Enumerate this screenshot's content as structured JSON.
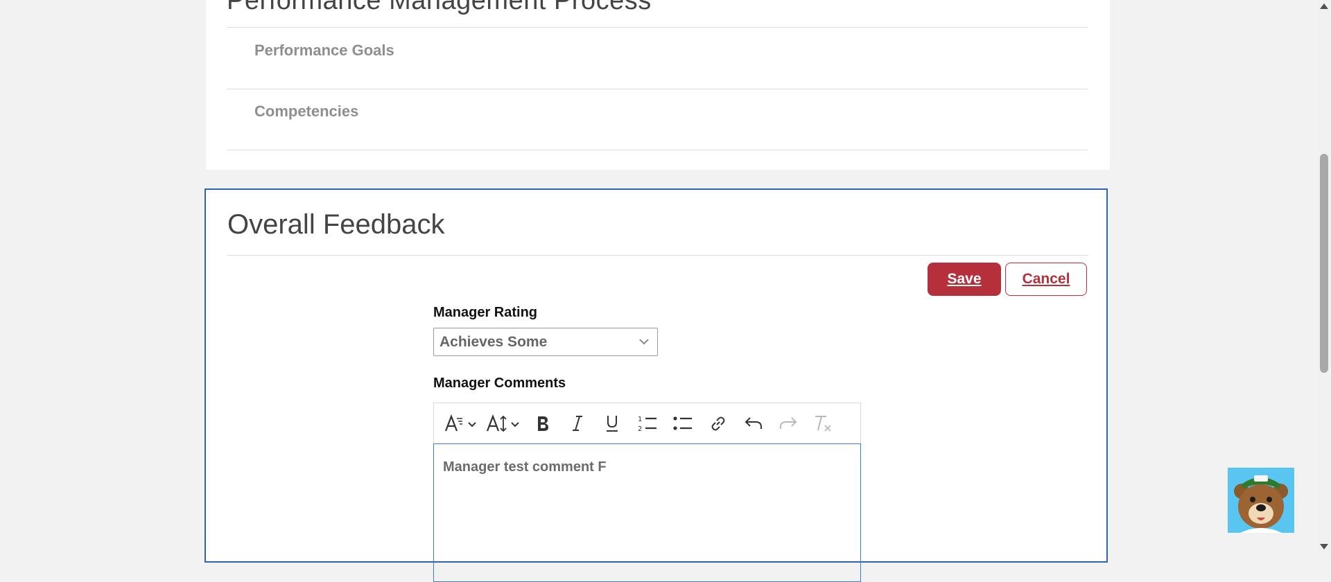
{
  "pmp": {
    "heading": "Performance Management Process",
    "items": [
      "Performance Goals",
      "Competencies"
    ]
  },
  "feedback": {
    "title": "Overall Feedback",
    "save_label": "Save",
    "cancel_label": "Cancel",
    "rating_label": "Manager Rating",
    "rating_value": "Achieves Some",
    "comments_label": "Manager Comments",
    "comment_text": "Manager test comment F"
  },
  "toolbar": {
    "items": [
      {
        "icon": "font-family-icon",
        "has_dropdown": true
      },
      {
        "icon": "font-size-icon",
        "has_dropdown": true
      },
      {
        "icon": "bold-icon"
      },
      {
        "icon": "italic-icon"
      },
      {
        "icon": "underline-icon"
      },
      {
        "icon": "numbered-list-icon"
      },
      {
        "icon": "bulleted-list-icon"
      },
      {
        "icon": "link-icon"
      },
      {
        "icon": "undo-icon"
      },
      {
        "icon": "redo-icon",
        "disabled": true
      },
      {
        "icon": "clear-formatting-icon",
        "disabled": true
      }
    ]
  },
  "colors": {
    "accent": "#b5303a",
    "card_border": "#2e63b8",
    "editor_border": "#3d7be0",
    "background": "#f2f2f2"
  },
  "mascot": {
    "icon": "bear-mascot-icon"
  }
}
